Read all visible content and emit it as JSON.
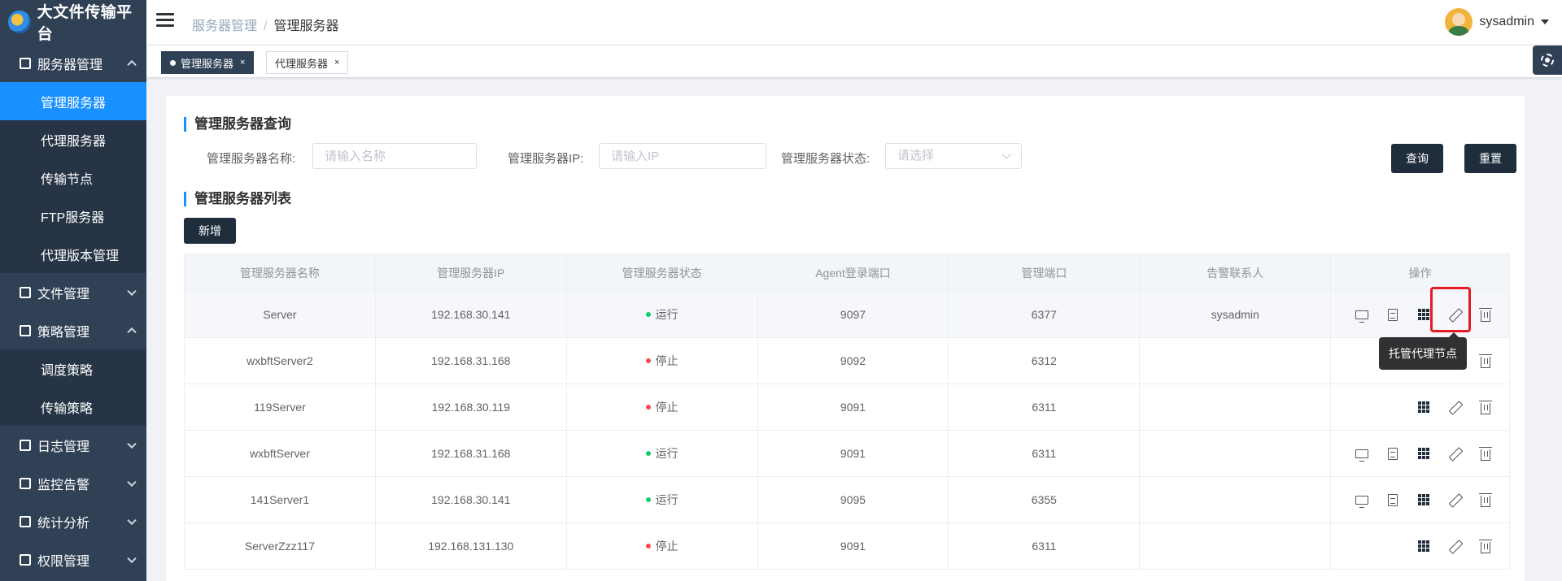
{
  "app": {
    "title": "大文件传输平台"
  },
  "sidebar": {
    "items": [
      {
        "label": "服务器管理",
        "expanded": true,
        "children": [
          {
            "label": "管理服务器",
            "active": true
          },
          {
            "label": "代理服务器"
          },
          {
            "label": "传输节点"
          },
          {
            "label": "FTP服务器"
          },
          {
            "label": "代理版本管理"
          }
        ]
      },
      {
        "label": "文件管理"
      },
      {
        "label": "策略管理",
        "expanded": true,
        "children": [
          {
            "label": "调度策略"
          },
          {
            "label": "传输策略"
          }
        ]
      },
      {
        "label": "日志管理"
      },
      {
        "label": "监控告警"
      },
      {
        "label": "统计分析"
      },
      {
        "label": "权限管理"
      }
    ]
  },
  "header": {
    "breadcrumb": [
      "服务器管理",
      "管理服务器"
    ],
    "breadcrumb_sep": "/",
    "user": "sysadmin"
  },
  "tags": [
    {
      "label": "管理服务器",
      "active": true,
      "close": "×"
    },
    {
      "label": "代理服务器",
      "active": false,
      "close": "×"
    }
  ],
  "query": {
    "title": "管理服务器查询",
    "name_label": "管理服务器名称:",
    "name_placeholder": "请输入名称",
    "ip_label": "管理服务器IP:",
    "ip_placeholder": "请输入IP",
    "status_label": "管理服务器状态:",
    "status_placeholder": "请选择",
    "search_btn": "查询",
    "reset_btn": "重置"
  },
  "list": {
    "title": "管理服务器列表",
    "add_btn": "新增",
    "columns": [
      "管理服务器名称",
      "管理服务器IP",
      "管理服务器状态",
      "Agent登录端口",
      "管理端口",
      "告警联系人",
      "操作"
    ],
    "rows": [
      {
        "name": "Server",
        "ip": "192.168.30.141",
        "status": "运行",
        "agent_port": "9097",
        "mgmt_port": "6377",
        "contact": "sysadmin",
        "ops": [
          "monitor",
          "doc",
          "grid",
          "edit",
          "trash"
        ]
      },
      {
        "name": "wxbftServer2",
        "ip": "192.168.31.168",
        "status": "停止",
        "agent_port": "9092",
        "mgmt_port": "6312",
        "contact": "",
        "ops": [
          "edit",
          "trash"
        ]
      },
      {
        "name": "119Server",
        "ip": "192.168.30.119",
        "status": "停止",
        "agent_port": "9091",
        "mgmt_port": "6311",
        "contact": "",
        "ops": [
          "grid",
          "edit",
          "trash"
        ]
      },
      {
        "name": "wxbftServer",
        "ip": "192.168.31.168",
        "status": "运行",
        "agent_port": "9091",
        "mgmt_port": "6311",
        "contact": "",
        "ops": [
          "monitor",
          "doc",
          "grid",
          "edit",
          "trash"
        ]
      },
      {
        "name": "141Server1",
        "ip": "192.168.30.141",
        "status": "运行",
        "agent_port": "9095",
        "mgmt_port": "6355",
        "contact": "",
        "ops": [
          "monitor",
          "doc",
          "grid",
          "edit",
          "trash"
        ]
      },
      {
        "name": "ServerZzz117",
        "ip": "192.168.131.130",
        "status": "停止",
        "agent_port": "9091",
        "mgmt_port": "6311",
        "contact": "",
        "ops": [
          "grid",
          "edit",
          "trash"
        ]
      }
    ]
  },
  "tooltip": {
    "text": "托管代理节点"
  },
  "colors": {
    "sidebar_bg": "#304156",
    "active_menu": "#1890ff",
    "running": "#13ce66",
    "stopped": "#ff4949",
    "highlight": "#e51c23"
  }
}
